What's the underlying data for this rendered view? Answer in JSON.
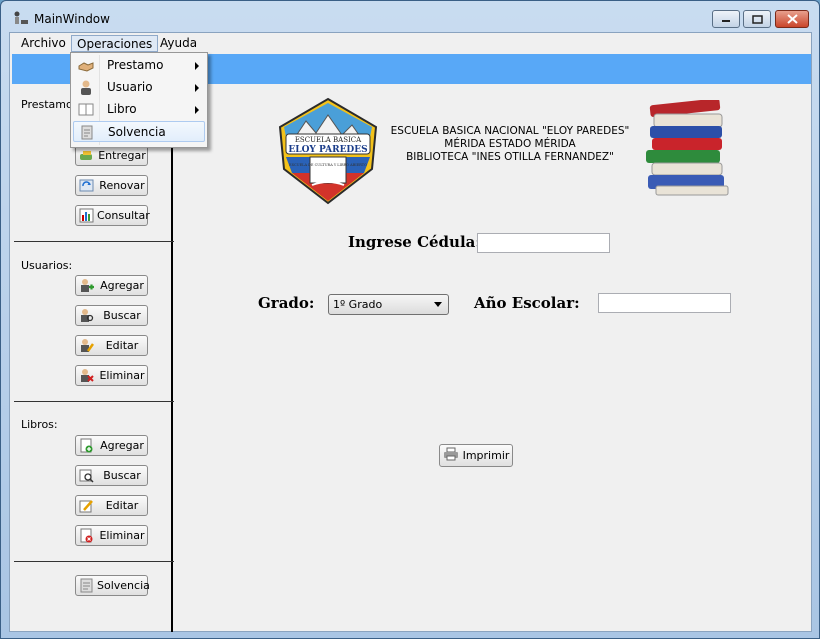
{
  "window": {
    "title": "MainWindow"
  },
  "menubar": {
    "items": [
      "Archivo",
      "Operaciones",
      "Ayuda"
    ],
    "active": "Operaciones"
  },
  "operaciones_menu": {
    "items": [
      {
        "label": "Prestamo",
        "submenu": true,
        "icon": "handshake-icon"
      },
      {
        "label": "Usuario",
        "submenu": true,
        "icon": "user-icon"
      },
      {
        "label": "Libro",
        "submenu": true,
        "icon": "book-icon"
      },
      {
        "label": "Solvencia",
        "submenu": false,
        "icon": "document-icon"
      }
    ]
  },
  "sidebar": {
    "prestamo": {
      "label": "Prestamo:",
      "buttons": [
        "Entregar",
        "Renovar",
        "Consultar"
      ]
    },
    "usuarios": {
      "label": "Usuarios:",
      "buttons": [
        "Agregar",
        "Buscar",
        "Editar",
        "Eliminar"
      ]
    },
    "libros": {
      "label": "Libros:",
      "buttons": [
        "Agregar",
        "Buscar",
        "Editar",
        "Eliminar"
      ]
    },
    "solvencia": {
      "button": "Solvencia"
    }
  },
  "header": {
    "line1": "ESCUELA BASICA NACIONAL \"ELOY PAREDES\"",
    "line2": "MÉRIDA ESTADO MÉRIDA",
    "line3": "BIBLIOTECA \"INES OTILLA FERNANDEZ\"",
    "crest_top": "ESCUELA BASICA",
    "crest_name": "ELOY PAREDES",
    "crest_book": "ESCUELA DE CULTURA Y LIBRO ABIERTO"
  },
  "form": {
    "cedula_label": "Ingrese Cédula:",
    "cedula_value": "",
    "grado_label": "Grado:",
    "grado_selected": "1º Grado",
    "anio_label": "Año Escolar:",
    "anio_value": "",
    "print_button": "Imprimir"
  },
  "colors": {
    "accent_bar": "#58a8f7",
    "title_bar": "#b9d1ea"
  }
}
